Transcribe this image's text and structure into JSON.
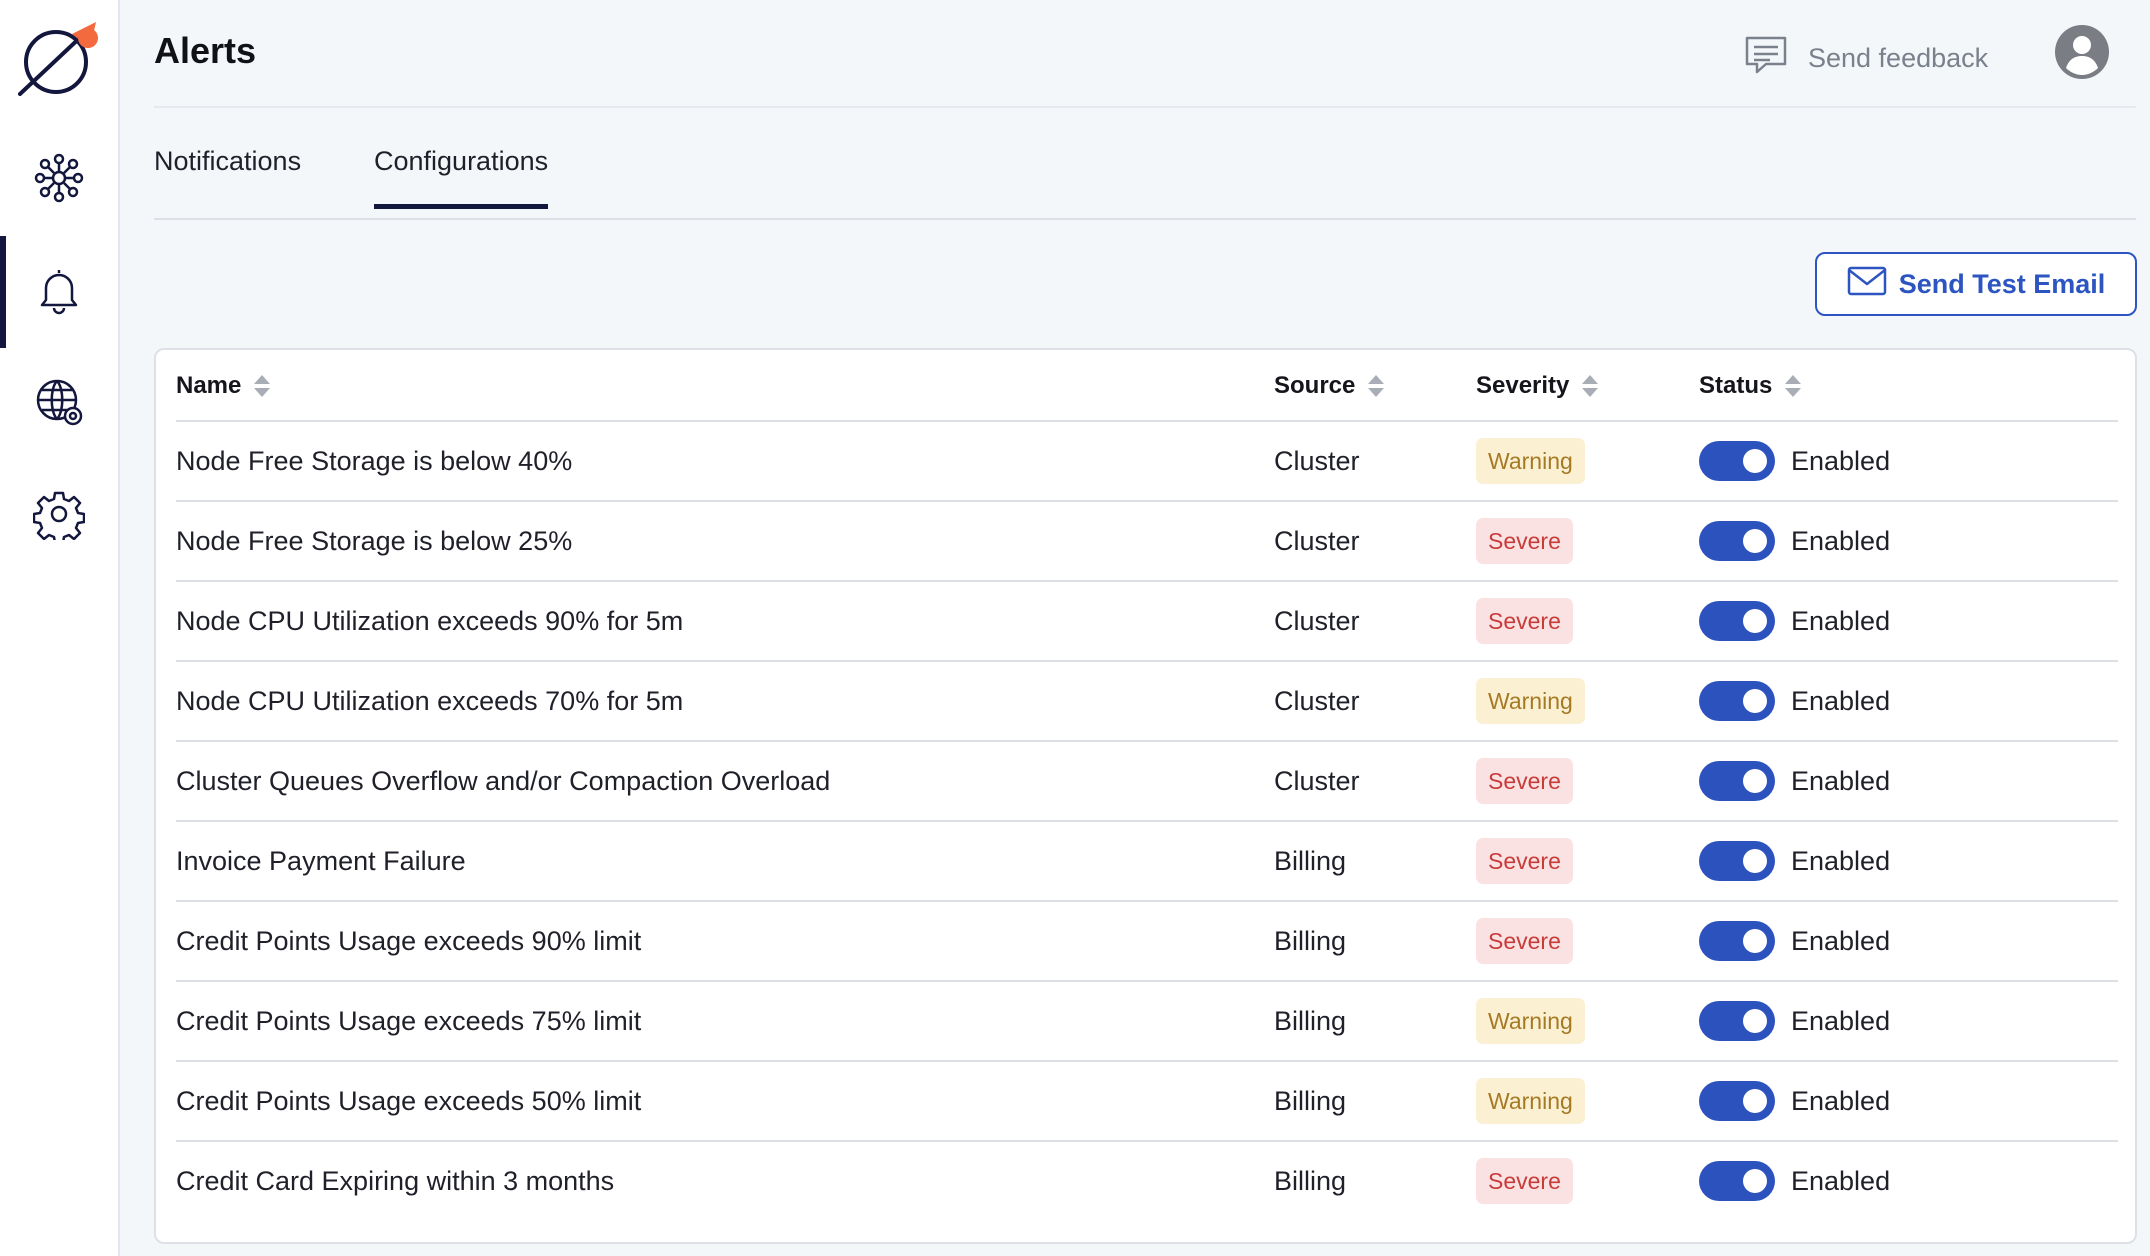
{
  "header": {
    "title": "Alerts",
    "feedback_label": "Send feedback"
  },
  "tabs": [
    {
      "label": "Notifications",
      "active": false
    },
    {
      "label": "Configurations",
      "active": true
    }
  ],
  "actions": {
    "send_test_email_label": "Send Test Email"
  },
  "sidebar": {
    "items": [
      {
        "icon": "cluster-network-icon",
        "active": false
      },
      {
        "icon": "bell-icon",
        "active": true
      },
      {
        "icon": "globe-settings-icon",
        "active": false
      },
      {
        "icon": "gear-icon",
        "active": false
      }
    ]
  },
  "table": {
    "columns": [
      "Name",
      "Source",
      "Severity",
      "Status"
    ],
    "rows": [
      {
        "name": "Node Free Storage is below 40%",
        "source": "Cluster",
        "severity": "Warning",
        "status": "Enabled"
      },
      {
        "name": "Node Free Storage is below 25%",
        "source": "Cluster",
        "severity": "Severe",
        "status": "Enabled"
      },
      {
        "name": "Node CPU Utilization exceeds 90% for 5m",
        "source": "Cluster",
        "severity": "Severe",
        "status": "Enabled"
      },
      {
        "name": "Node CPU Utilization exceeds 70% for 5m",
        "source": "Cluster",
        "severity": "Warning",
        "status": "Enabled"
      },
      {
        "name": "Cluster Queues Overflow and/or Compaction Overload",
        "source": "Cluster",
        "severity": "Severe",
        "status": "Enabled"
      },
      {
        "name": "Invoice Payment Failure",
        "source": "Billing",
        "severity": "Severe",
        "status": "Enabled"
      },
      {
        "name": "Credit Points Usage exceeds 90% limit",
        "source": "Billing",
        "severity": "Severe",
        "status": "Enabled"
      },
      {
        "name": "Credit Points Usage exceeds 75% limit",
        "source": "Billing",
        "severity": "Warning",
        "status": "Enabled"
      },
      {
        "name": "Credit Points Usage exceeds 50% limit",
        "source": "Billing",
        "severity": "Warning",
        "status": "Enabled"
      },
      {
        "name": "Credit Card Expiring within 3 months",
        "source": "Billing",
        "severity": "Severe",
        "status": "Enabled"
      }
    ]
  },
  "colors": {
    "accent": "#2c52be",
    "nav_active": "#13163d",
    "logo_rocket": "#f26a3d",
    "warning_bg": "#fbf0d2",
    "warning_fg": "#a57a24",
    "severe_bg": "#fbe2e2",
    "severe_fg": "#c83b3b"
  }
}
